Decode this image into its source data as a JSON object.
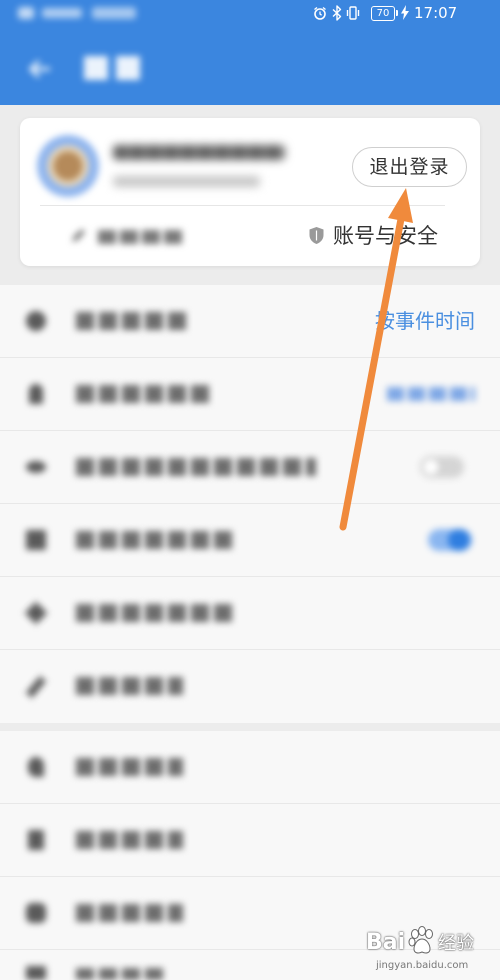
{
  "status_bar": {
    "time": "17:07",
    "battery": "70",
    "icons": [
      "alarm-icon",
      "bluetooth-icon",
      "vibrate-icon",
      "battery-icon",
      "charging-icon"
    ]
  },
  "header": {
    "icons": [
      "back-arrow-icon"
    ]
  },
  "account": {
    "logout_label": "退出登录",
    "security_label": "账号与安全",
    "icons": [
      "avatar",
      "pencil-icon",
      "shield-icon"
    ]
  },
  "settings": {
    "rows": [
      {
        "value": "按事件时间"
      }
    ],
    "toggles": {
      "row_3_on": false,
      "row_4_on": true
    }
  },
  "watermark": {
    "brand_left": "Bai",
    "brand_right": "经验",
    "domain": "jingyan.baidu.com"
  },
  "colors": {
    "header": "#3b86df",
    "accent": "#4a8fe0",
    "annotation_arrow": "#f08a3c"
  }
}
